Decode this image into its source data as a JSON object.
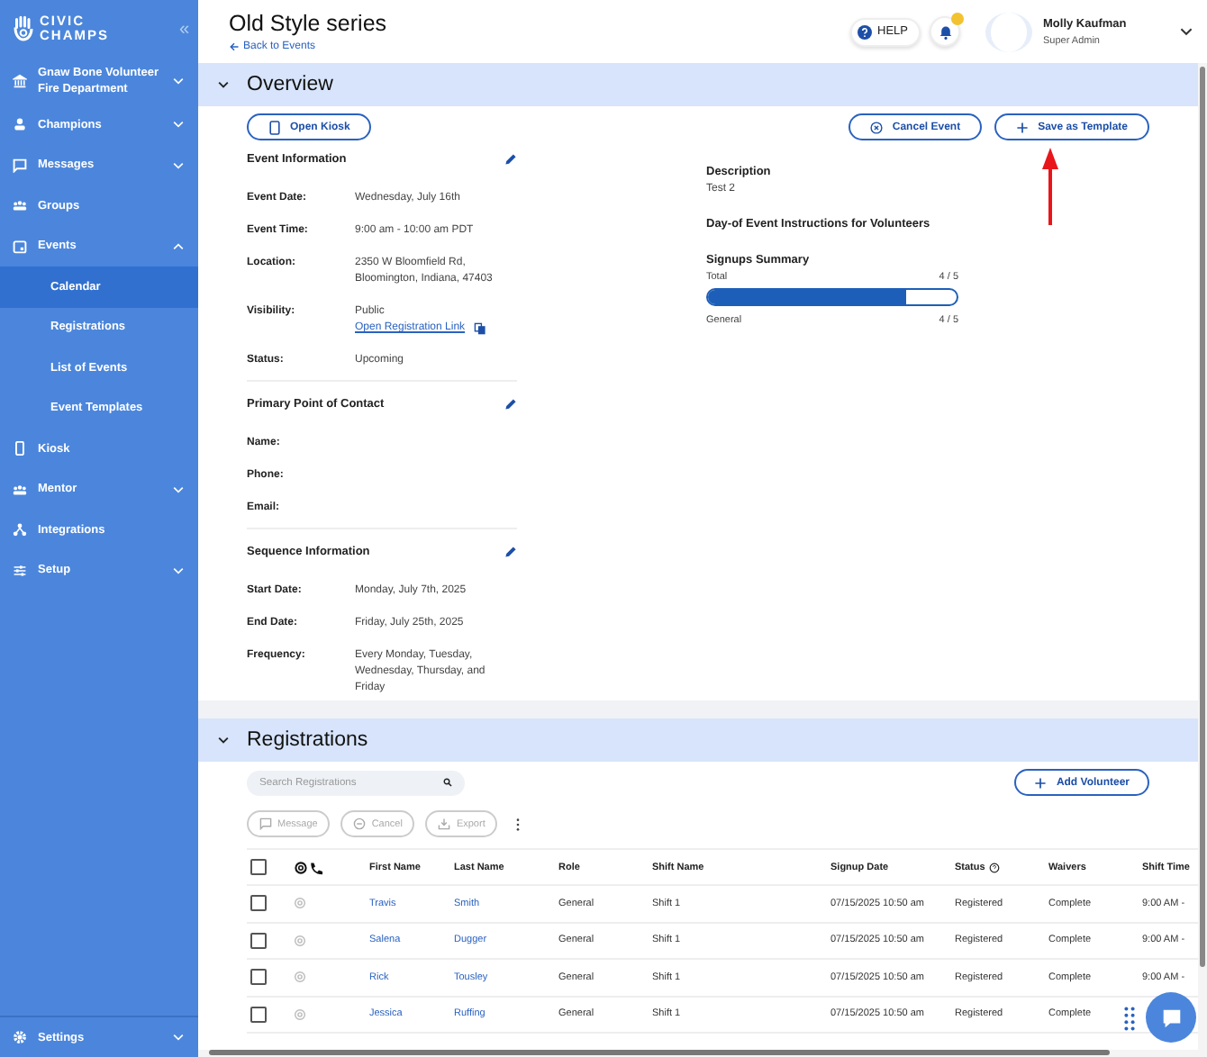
{
  "sidebar": {
    "logo_lines": [
      "CIVIC",
      "CHAMPS"
    ],
    "collapse_icon": "«",
    "items": [
      {
        "label": "Gnaw Bone Volunteer Fire Department",
        "kind": "expandable",
        "expanded": false
      },
      {
        "label": "Champions",
        "kind": "expandable",
        "expanded": false
      },
      {
        "label": "Messages",
        "kind": "expandable",
        "expanded": false
      },
      {
        "label": "Groups",
        "kind": "link"
      },
      {
        "label": "Events",
        "kind": "expandable",
        "expanded": true,
        "children": [
          {
            "label": "Calendar",
            "selected": true
          },
          {
            "label": "Registrations",
            "selected": false
          },
          {
            "label": "List of Events",
            "selected": false
          },
          {
            "label": "Event Templates",
            "selected": false
          }
        ]
      },
      {
        "label": "Kiosk",
        "kind": "link"
      },
      {
        "label": "Mentor",
        "kind": "expandable",
        "expanded": false
      },
      {
        "label": "Integrations",
        "kind": "link"
      },
      {
        "label": "Setup",
        "kind": "expandable",
        "expanded": false
      }
    ],
    "footer": {
      "label": "Settings",
      "expanded": false
    }
  },
  "header": {
    "title": "Old Style series",
    "back_link": "Back to Events",
    "help": "HELP",
    "has_notification": true,
    "user_name": "Molly Kaufman",
    "user_role": "Super Admin"
  },
  "overview": {
    "title": "Overview",
    "expanded": true,
    "left_buttons": [
      "Open Kiosk"
    ],
    "right_buttons": [
      "Cancel Event",
      "Save as Template"
    ],
    "sections": [
      {
        "title": "Event Information",
        "rows": [
          {
            "label": "Event Date:",
            "value": "Wednesday, July 16th"
          },
          {
            "label": "Event Time:",
            "value": "9:00 am - 10:00 am PDT"
          },
          {
            "label": "Location:",
            "value": "2350 W Bloomfield Rd, Bloomington, Indiana, 47403"
          },
          {
            "label": "Visibility:",
            "value": "Public",
            "link": "Open Registration Link"
          },
          {
            "label": "Status:",
            "value": "Upcoming"
          }
        ]
      },
      {
        "title": "Primary Point of Contact",
        "rows": [
          {
            "label": "Name:"
          },
          {
            "label": "Phone:"
          },
          {
            "label": "Email:"
          }
        ]
      },
      {
        "title": "Sequence Information",
        "rows": [
          {
            "label": "Start Date:",
            "value": "Monday, July 7th, 2025"
          },
          {
            "label": "End Date:",
            "value": "Friday, July 25th, 2025"
          },
          {
            "label": "Frequency:",
            "value": "Every Monday, Tuesday, Wednesday, Thursday, and Friday"
          }
        ]
      }
    ],
    "description_title": "Description",
    "description": "Test 2",
    "instructions_title": "Day-of Event Instructions for Volunteers",
    "signups": {
      "title": "Signups Summary",
      "total_label": "Total",
      "total_reading": "4 / 5",
      "level": 0.8,
      "rows": [
        {
          "label": "General",
          "reading": "4 / 5"
        }
      ]
    }
  },
  "registrations": {
    "title": "Registrations",
    "expanded": true,
    "search": {
      "placeholder": "Search Registrations"
    },
    "add_button": "Add Volunteer",
    "actions": [
      {
        "label": "Message",
        "disabled": true
      },
      {
        "label": "Cancel",
        "disabled": true
      },
      {
        "label": "Export",
        "disabled": true
      }
    ],
    "table": {
      "columns": [
        "First Name",
        "Last Name",
        "Role",
        "Shift Name",
        "Signup Date",
        "Status",
        "Waivers",
        "Shift Time"
      ],
      "all_checked": false,
      "rows": [
        {
          "checked": false,
          "cells": [
            "Travis",
            "Smith",
            "General",
            "Shift 1",
            "07/15/2025 10:50 am",
            "Registered",
            "Complete",
            "9:00 AM -"
          ]
        },
        {
          "checked": false,
          "cells": [
            "Salena",
            "Dugger",
            "General",
            "Shift 1",
            "07/15/2025 10:50 am",
            "Registered",
            "Complete",
            "9:00 AM -"
          ]
        },
        {
          "checked": false,
          "cells": [
            "Rick",
            "Tousley",
            "General",
            "Shift 1",
            "07/15/2025 10:50 am",
            "Registered",
            "Complete",
            "9:00 AM -"
          ]
        },
        {
          "checked": false,
          "cells": [
            "Jessica",
            "Ruffing",
            "General",
            "Shift 1",
            "07/15/2025 10:50 am",
            "Registered",
            "Complete"
          ]
        }
      ]
    }
  }
}
